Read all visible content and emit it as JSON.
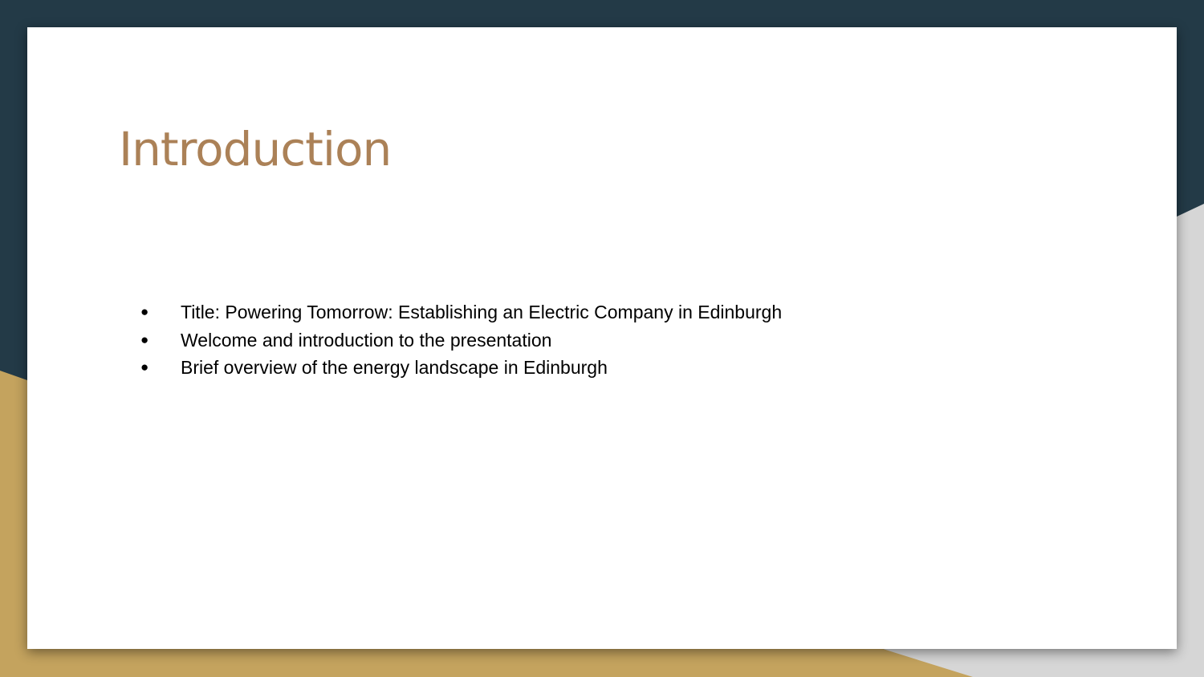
{
  "slide": {
    "title": "Introduction",
    "bullets": [
      "Title: Powering Tomorrow: Establishing an Electric Company in Edinburgh",
      "Welcome and introduction to the presentation",
      "Brief overview of the energy landscape in Edinburgh"
    ],
    "bullet_glyph": "●"
  },
  "theme": {
    "background_dark": "#233a47",
    "accent_gold": "#c4a35e",
    "accent_gray": "#d6d6d6",
    "title_color": "#ab8157",
    "text_color": "#000000"
  }
}
